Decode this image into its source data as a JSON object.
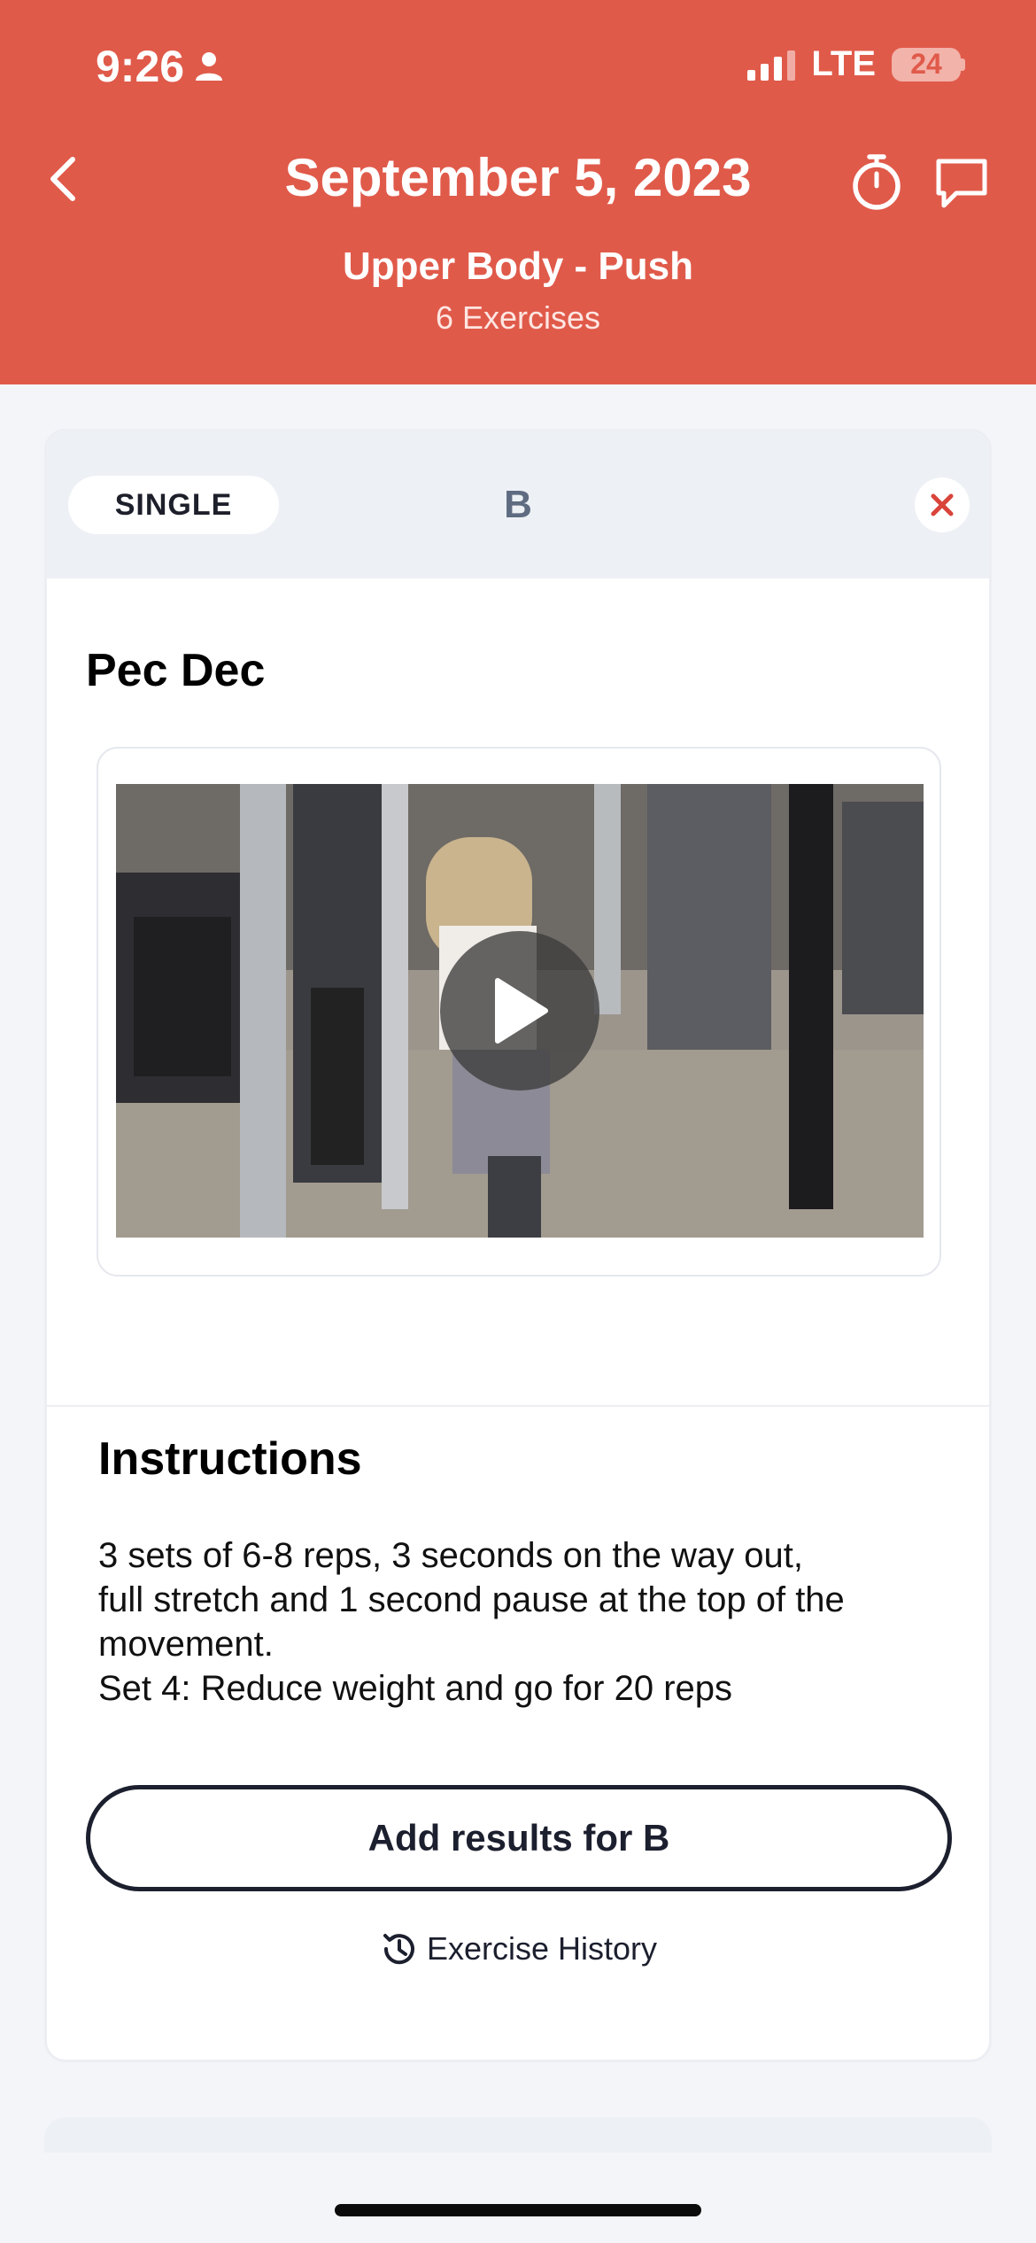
{
  "status_bar": {
    "time": "9:26",
    "network": "LTE",
    "battery": "24"
  },
  "header": {
    "date": "September 5, 2023",
    "workout_name": "Upper Body - Push",
    "exercise_count": "6 Exercises"
  },
  "card": {
    "type_label": "SINGLE",
    "block_letter": "B",
    "exercise_name": "Pec Dec",
    "instructions_title": "Instructions",
    "instructions_lines": [
      "3 sets of 6-8 reps, 3 seconds on the way out,",
      "full stretch and 1 second pause at the top of the",
      "movement.",
      "Set 4: Reduce weight and go for 20 reps"
    ],
    "add_results_label": "Add results for B",
    "history_label": "Exercise History"
  },
  "icons": [
    "back-chevron-icon",
    "stopwatch-icon",
    "chat-icon",
    "close-icon",
    "play-icon",
    "history-icon"
  ],
  "colors": {
    "header": "#e05a4a",
    "close_x": "#d9443b",
    "button_border": "#1c1f2e"
  }
}
